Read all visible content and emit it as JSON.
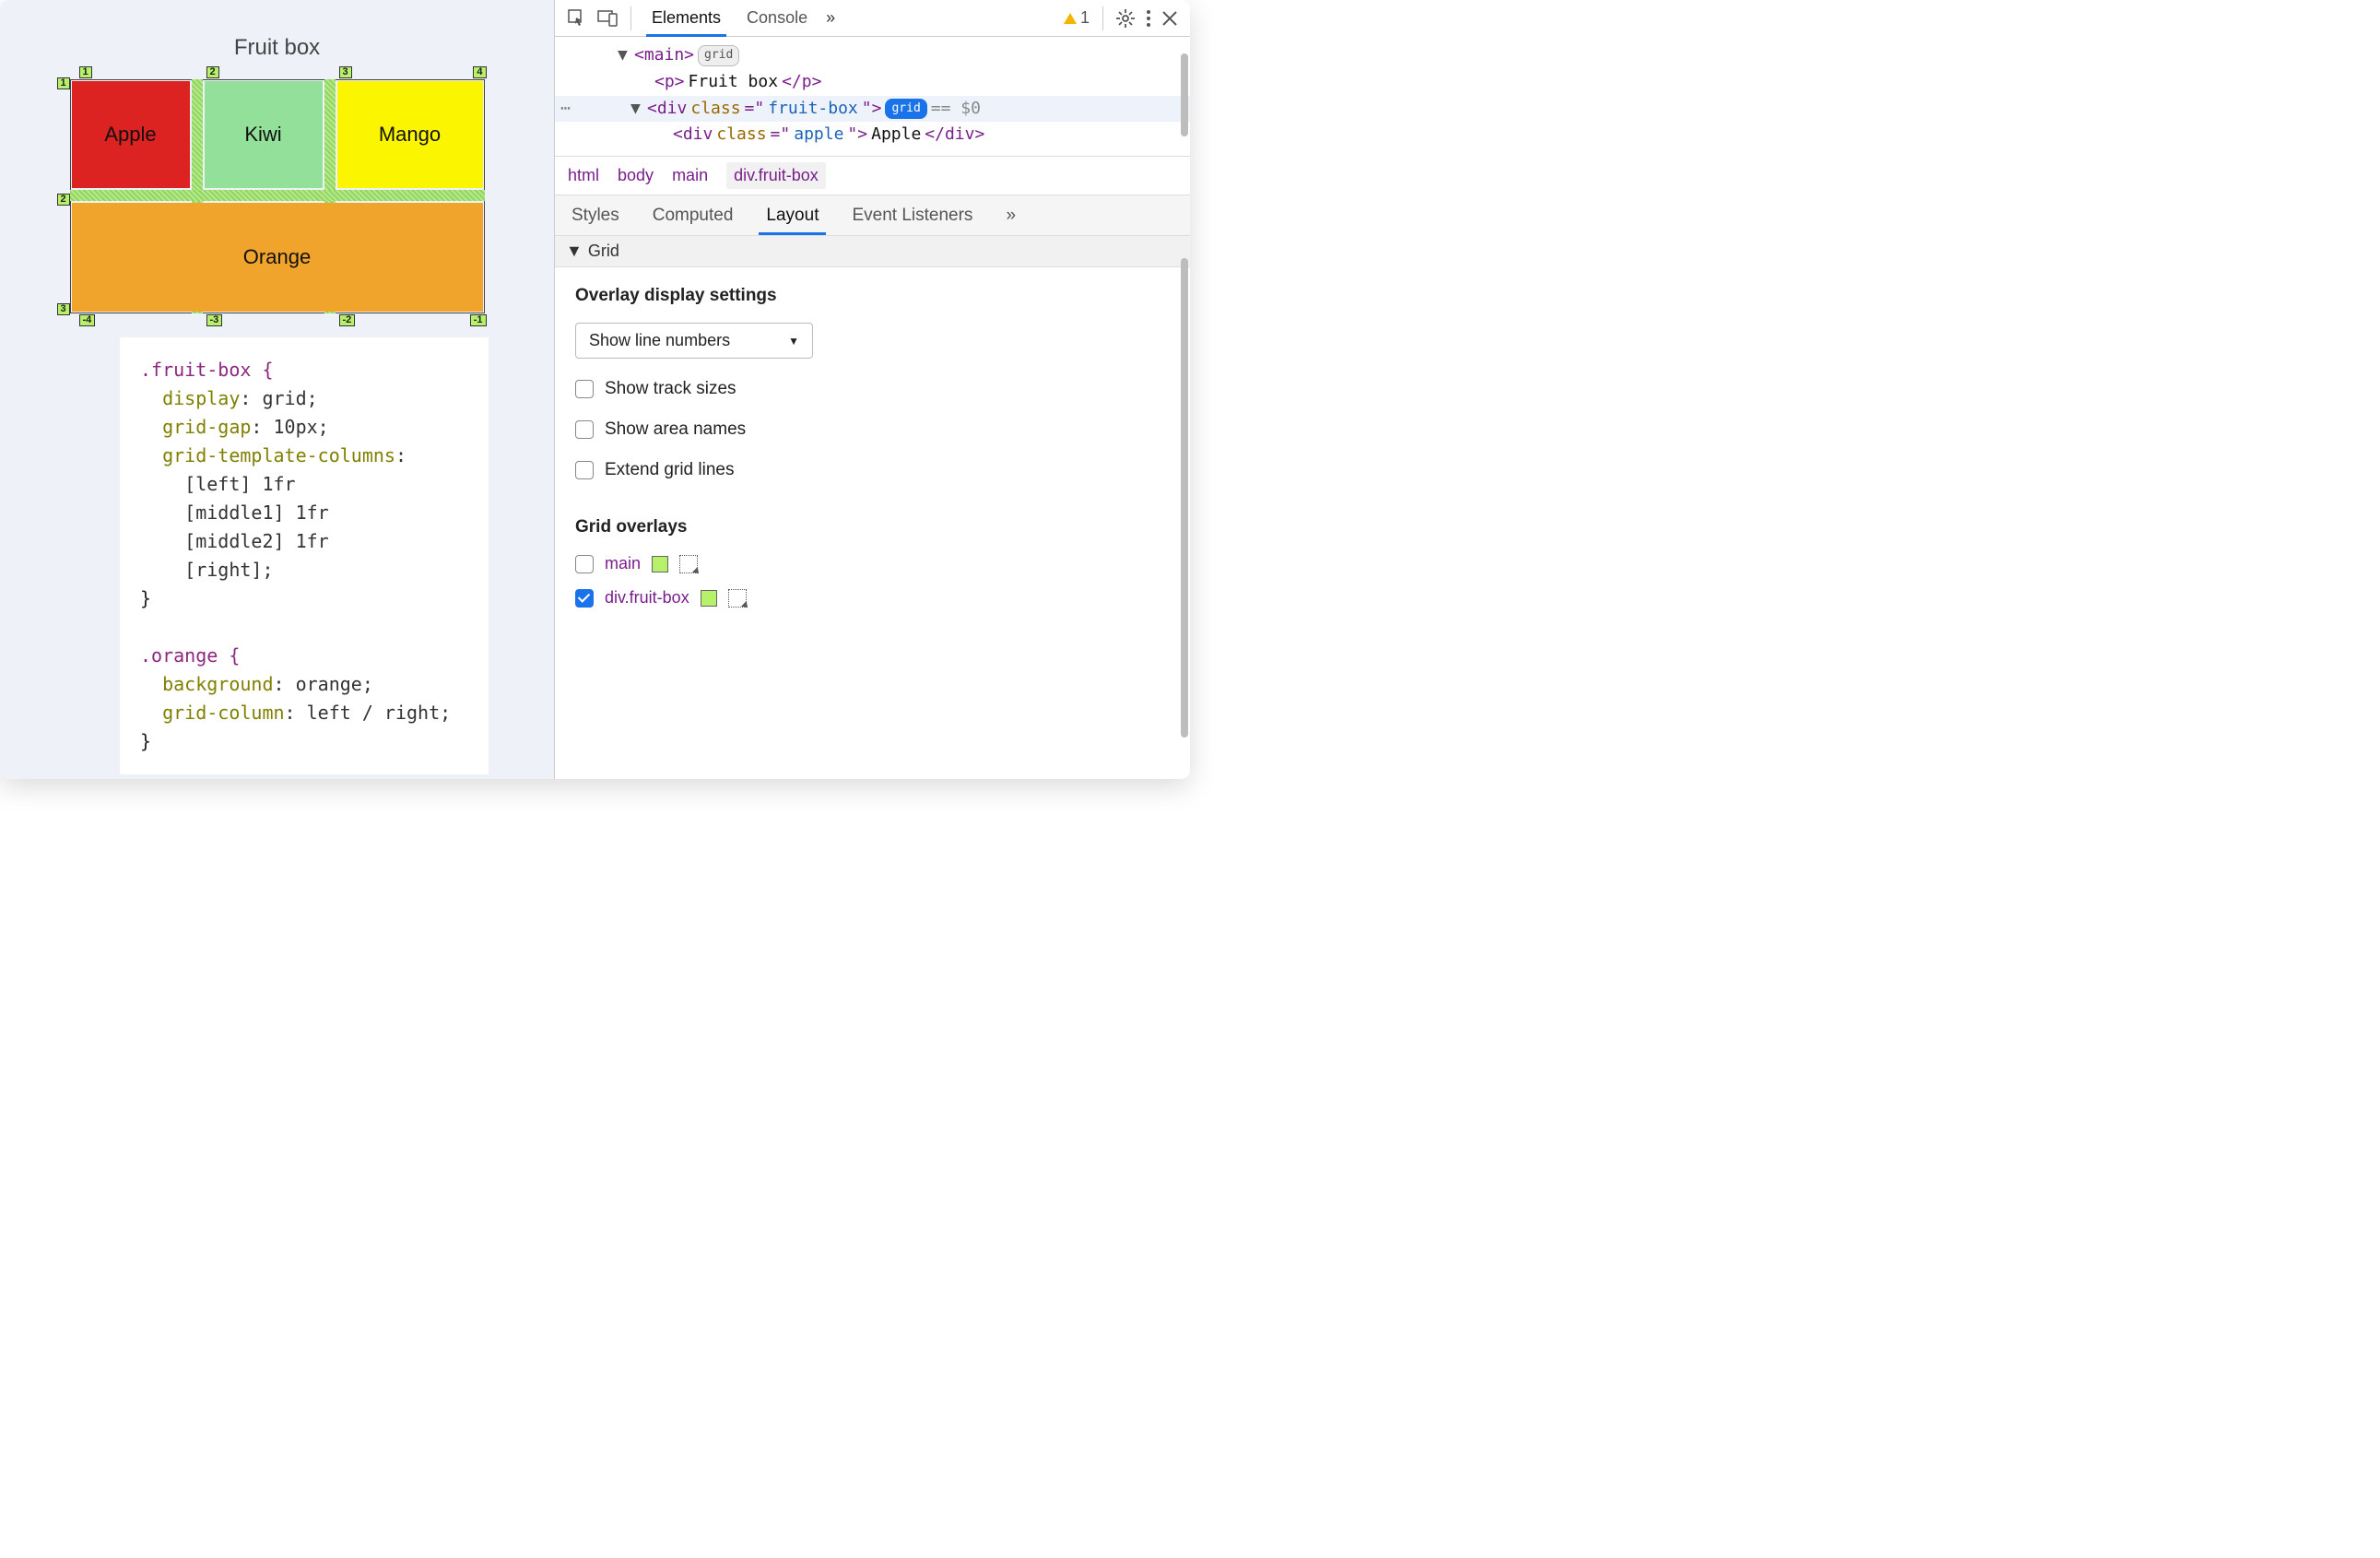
{
  "page": {
    "title": "Fruit box",
    "cells": {
      "apple": "Apple",
      "kiwi": "Kiwi",
      "mango": "Mango",
      "orange": "Orange"
    },
    "grid_labels": {
      "top": [
        "1",
        "2",
        "3",
        "4"
      ],
      "bottom": [
        "-4",
        "-3",
        "-2",
        "-1"
      ],
      "left": [
        "1",
        "2",
        "3"
      ]
    }
  },
  "css": {
    "rule1_selector": ".fruit-box {",
    "rule1_p1": "  display",
    "rule1_v1": ": grid;",
    "rule1_p2": "  grid-gap",
    "rule1_v2": ": 10px;",
    "rule1_p3": "  grid-template-columns",
    "rule1_v3": ":",
    "rule1_l1": "    [left] 1fr",
    "rule1_l2": "    [middle1] 1fr",
    "rule1_l3": "    [middle2] 1fr",
    "rule1_l4": "    [right];",
    "rule1_close": "}",
    "rule2_selector": ".orange {",
    "rule2_p1": "  background",
    "rule2_v1": ": orange;",
    "rule2_p2": "  grid-column",
    "rule2_v2": ": left / right;",
    "rule2_close": "}"
  },
  "devtools": {
    "toolbar": {
      "tabs": {
        "elements": "Elements",
        "console": "Console"
      },
      "more": "»",
      "warn_count": "1"
    },
    "dom": {
      "main_open": "<main>",
      "main_badge": "grid",
      "p_open": "<p>",
      "p_text": "Fruit box",
      "p_close": "</p>",
      "div_open_prefix": "<div ",
      "div_attr_name": "class",
      "div_eq": "=\"",
      "div_attr_val": "fruit-box",
      "div_close_q": "\">",
      "div_badge": "grid",
      "sel_eq": " == $0",
      "apple_open_prefix": "<div ",
      "apple_attr_name": "class",
      "apple_attr_val": "apple",
      "apple_text": "Apple",
      "apple_close": "</div>",
      "ellipsis": "…"
    },
    "breadcrumb": [
      "html",
      "body",
      "main",
      "div.fruit-box"
    ],
    "subtabs": {
      "styles": "Styles",
      "computed": "Computed",
      "layout": "Layout",
      "listeners": "Event Listeners",
      "more": "»"
    },
    "grid_section": "Grid",
    "overlay_settings": {
      "title": "Overlay display settings",
      "select": "Show line numbers",
      "opts": [
        "Show track sizes",
        "Show area names",
        "Extend grid lines"
      ]
    },
    "grid_overlays": {
      "title": "Grid overlays",
      "rows": [
        {
          "name": "main",
          "checked": false,
          "color": "#b7f06a"
        },
        {
          "name": "div.fruit-box",
          "checked": true,
          "color": "#b7f06a"
        }
      ]
    }
  }
}
